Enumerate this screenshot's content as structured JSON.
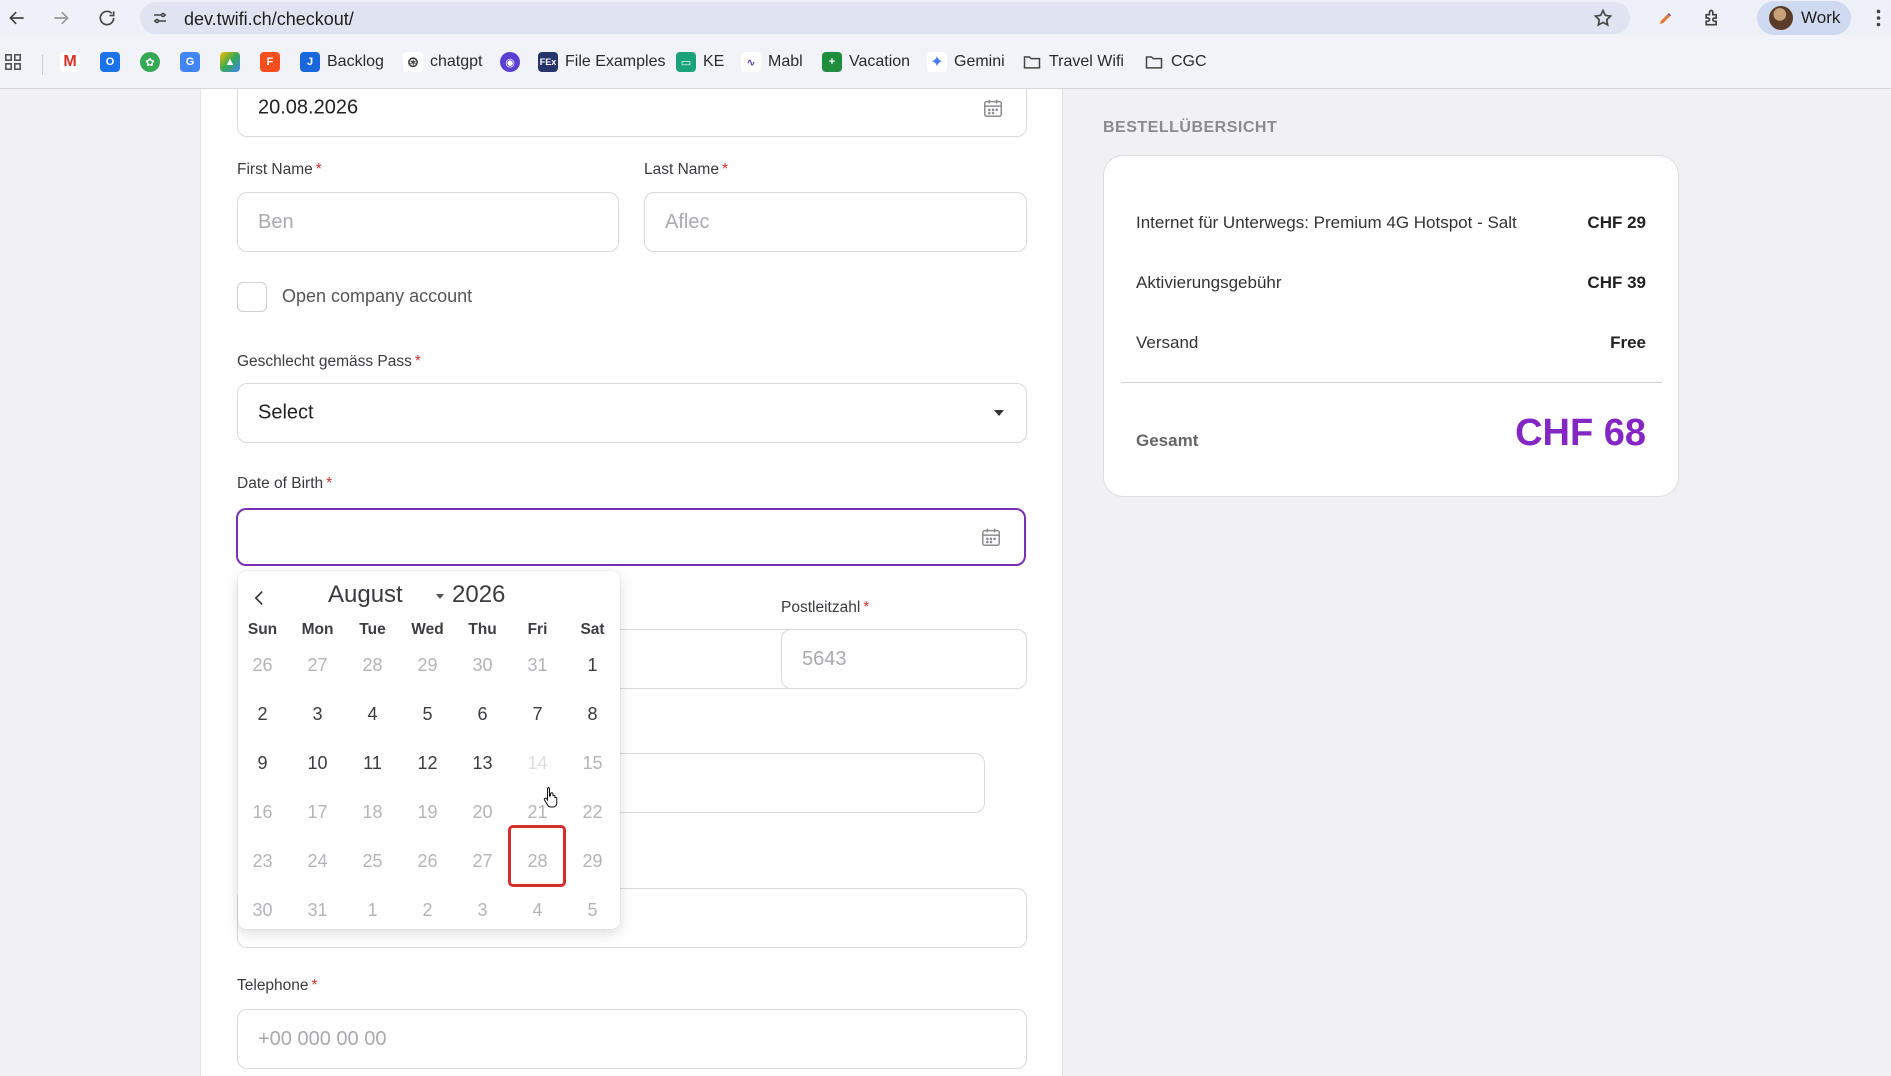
{
  "browser": {
    "url": "dev.twifi.ch/checkout/",
    "profile_name": "Work"
  },
  "bookmarks": [
    {
      "label": "Backlog",
      "icon": "jira-icon"
    },
    {
      "label": "chatgpt",
      "icon": "chatgpt-icon"
    },
    {
      "label": "File Examples",
      "icon": "file-examples-icon"
    },
    {
      "label": "KE",
      "icon": "ke-icon"
    },
    {
      "label": "Mabl",
      "icon": "mabl-icon"
    },
    {
      "label": "Vacation",
      "icon": "sheets-icon"
    },
    {
      "label": "Gemini",
      "icon": "gemini-icon"
    },
    {
      "label": "Travel Wifi",
      "icon": "folder-icon"
    },
    {
      "label": "CGC",
      "icon": "folder-icon"
    }
  ],
  "form": {
    "date_top_value": "20.08.2026",
    "first_name_label": "First Name",
    "first_name_placeholder": "Ben",
    "last_name_label": "Last Name",
    "last_name_placeholder": "Aflec",
    "company_account_label": "Open company account",
    "gender_label": "Geschlecht gemäss Pass",
    "gender_value": "Select",
    "dob_label": "Date of Birth",
    "postal_label": "Postleitzahl",
    "postal_placeholder": "5643",
    "telephone_label": "Telephone",
    "telephone_placeholder": "+00 000 00 00",
    "required_mark": "*"
  },
  "datepicker": {
    "month": "August",
    "year": "2026",
    "weekdays": [
      "Sun",
      "Mon",
      "Tue",
      "Wed",
      "Thu",
      "Fri",
      "Sat"
    ],
    "weeks": [
      [
        "26",
        "27",
        "28",
        "29",
        "30",
        "31",
        "1"
      ],
      [
        "2",
        "3",
        "4",
        "5",
        "6",
        "7",
        "8"
      ],
      [
        "9",
        "10",
        "11",
        "12",
        "13",
        "14",
        "15"
      ],
      [
        "16",
        "17",
        "18",
        "19",
        "20",
        "21",
        "22"
      ],
      [
        "23",
        "24",
        "25",
        "26",
        "27",
        "28",
        "29"
      ],
      [
        "30",
        "31",
        "1",
        "2",
        "3",
        "4",
        "5"
      ]
    ],
    "hovered_day": "14"
  },
  "summary": {
    "title": "BESTELLÜBERSICHT",
    "items": [
      {
        "label": "Internet für Unterwegs: Premium 4G Hotspot - Salt",
        "value": "CHF 29"
      },
      {
        "label": "Aktivierungsgebühr",
        "value": "CHF 39"
      },
      {
        "label": "Versand",
        "value": "Free"
      }
    ],
    "total_label": "Gesamt",
    "total_value": "CHF 68",
    "accent_color": "#8426c4"
  },
  "colors": {
    "focus_border": "#7a2fb6",
    "required": "#d0302f",
    "highlight_box": "#d32f2f"
  }
}
